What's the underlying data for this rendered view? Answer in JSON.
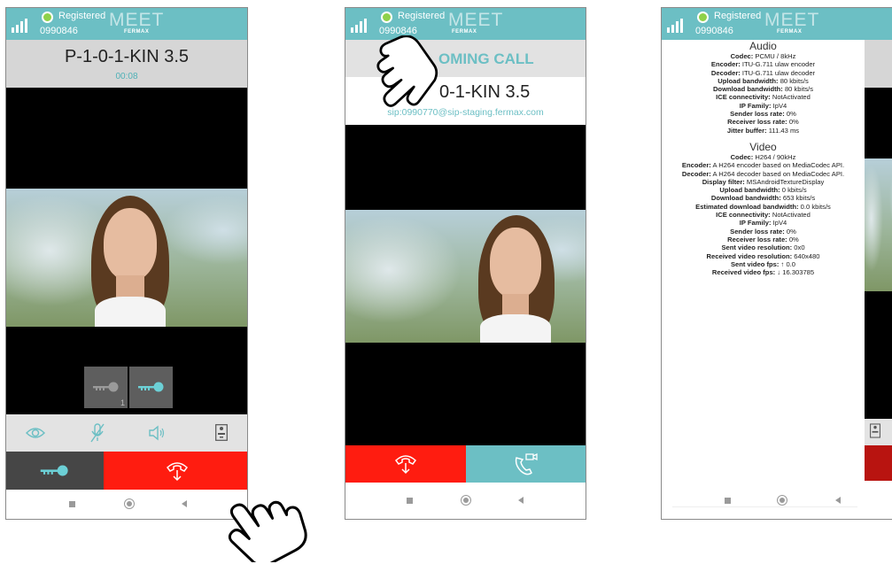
{
  "status": {
    "registered_label": "Registered",
    "device_code": "0990846",
    "brand_logo": "MEET",
    "brand_sub": "FERMAX"
  },
  "panel1": {
    "caller_name": "P-1-0-1-KIN 3.5",
    "call_timer": "00:08",
    "relay_badge": "1",
    "icons": [
      "key-icon",
      "key-icon",
      "eye-icon",
      "mic-off-icon",
      "speaker-icon",
      "intercom-panel-icon",
      "key-icon",
      "hang-up-icon"
    ]
  },
  "panel2": {
    "banner_text": "OMING CALL",
    "caller_name": "0-1-KIN 3.5",
    "sip_address": "sip:0990770@sip-staging.fermax.com",
    "icons": [
      "hang-up-icon",
      "video-call-icon"
    ]
  },
  "panel3": {
    "audio_title": "Audio",
    "audio": [
      {
        "k": "Codec:",
        "v": "PCMU / 8kHz"
      },
      {
        "k": "Encoder:",
        "v": "ITU-G.711 ulaw encoder"
      },
      {
        "k": "Decoder:",
        "v": "ITU-G.711 ulaw decoder"
      },
      {
        "k": "Upload bandwidth:",
        "v": "80 kbits/s"
      },
      {
        "k": "Download bandwidth:",
        "v": "80 kbits/s"
      },
      {
        "k": "ICE connectivity:",
        "v": "NotActivated"
      },
      {
        "k": "IP Family:",
        "v": "IpV4"
      },
      {
        "k": "Sender loss rate:",
        "v": "0%"
      },
      {
        "k": "Receiver loss rate:",
        "v": "0%"
      },
      {
        "k": "Jitter buffer:",
        "v": "111.43 ms"
      }
    ],
    "video_title": "Video",
    "video": [
      {
        "k": "Codec:",
        "v": "H264 / 90kHz"
      },
      {
        "k": "Encoder:",
        "v": "A H264 encoder based on MediaCodec API."
      },
      {
        "k": "Decoder:",
        "v": "A H264 decoder based on MediaCodec API."
      },
      {
        "k": "Display filter:",
        "v": "MSAndroidTextureDisplay"
      },
      {
        "k": "Upload bandwidth:",
        "v": "0 kbits/s"
      },
      {
        "k": "Download bandwidth:",
        "v": "653 kbits/s"
      },
      {
        "k": "Estimated download bandwidth:",
        "v": "0.0 kbits/s"
      },
      {
        "k": "ICE connectivity:",
        "v": "NotActivated"
      },
      {
        "k": "IP Family:",
        "v": "IpV4"
      },
      {
        "k": "Sender loss rate:",
        "v": "0%"
      },
      {
        "k": "Receiver loss rate:",
        "v": "0%"
      },
      {
        "k": "Sent video resolution:",
        "v": "0x0"
      },
      {
        "k": "Received video resolution:",
        "v": "640x480"
      },
      {
        "k": "Sent video fps:",
        "v": "↑ 0.0"
      },
      {
        "k": "Received video fps:",
        "v": "↓ 16.303785"
      }
    ]
  },
  "colors": {
    "teal": "#6cbfc4",
    "red": "#ff1c10",
    "dark": "#464646",
    "accent_green": "#8fd14a"
  }
}
